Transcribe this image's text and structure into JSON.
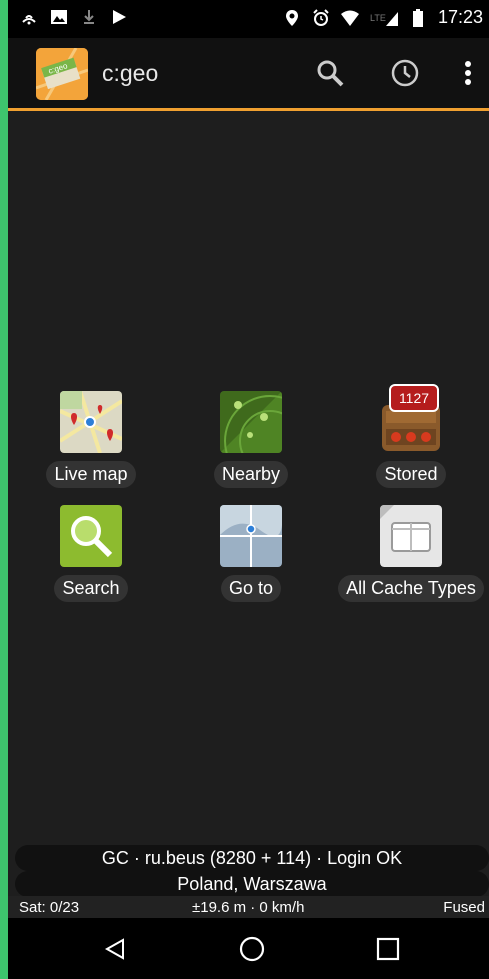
{
  "status_bar": {
    "time": "17:23",
    "network_label": "LTE",
    "icons_left": [
      "nfc-icon",
      "image-icon",
      "download-icon",
      "play-store-icon"
    ],
    "icons_right": [
      "location-icon",
      "alarm-icon",
      "wifi-icon",
      "signal-icon",
      "battery-icon"
    ]
  },
  "app_bar": {
    "title": "c:geo",
    "logo_text": "c:geo",
    "actions": [
      "search-icon",
      "history-icon",
      "overflow-menu-icon"
    ]
  },
  "tiles": [
    {
      "label": "Live map",
      "icon": "live-map-icon"
    },
    {
      "label": "Nearby",
      "icon": "nearby-radar-icon"
    },
    {
      "label": "Stored",
      "icon": "stored-caches-icon"
    },
    {
      "label": "Search",
      "icon": "search-magnifier-icon"
    },
    {
      "label": "Go to",
      "icon": "go-to-map-icon"
    },
    {
      "label": "All Cache Types",
      "icon": "all-cache-types-icon"
    }
  ],
  "stored_count": "1127",
  "info": {
    "login_status": "GC · ru.beus (8280 + 114) · Login OK",
    "location": "Poland, Warszawa",
    "satellites": "Sat: 0/23",
    "accuracy_speed": "±19.6 m · 0 km/h",
    "provider": "Fused"
  },
  "nav_bar": [
    "back-icon",
    "home-icon",
    "recents-icon"
  ],
  "colors": {
    "accent": "#f0a030",
    "background": "#1e1e1e",
    "frame": "#3ec46d"
  }
}
